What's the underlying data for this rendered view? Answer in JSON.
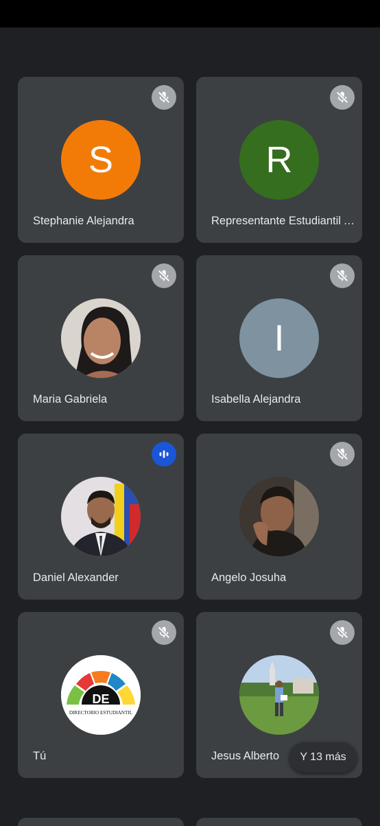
{
  "participants": [
    {
      "name": "Stephanie Alejandra",
      "initial": "S",
      "avatar_color": "#f27b08",
      "mic": "muted"
    },
    {
      "name": "Representante Estudiantil A...",
      "initial": "R",
      "avatar_color": "#356e1e",
      "mic": "muted"
    },
    {
      "name": "Maria Gabriela",
      "initial": "",
      "avatar_color": "#7a6a60",
      "mic": "muted"
    },
    {
      "name": "Isabella Alejandra",
      "initial": "I",
      "avatar_color": "#7e939f",
      "mic": "muted"
    },
    {
      "name": "Daniel Alexander",
      "initial": "",
      "avatar_color": "#5a4a50",
      "mic": "speaking"
    },
    {
      "name": "Angelo Josuha",
      "initial": "",
      "avatar_color": "#4a3e36",
      "mic": "muted"
    },
    {
      "name": "Tú",
      "initial": "",
      "avatar_color": "#ffffff",
      "mic": "muted",
      "logo_text": "DE",
      "logo_caption": "DIRECTORIO ESTUDIANTIL"
    },
    {
      "name": "Jesus Alberto",
      "initial": "",
      "avatar_color": "#6f8f50",
      "mic": "muted"
    }
  ],
  "more_button": {
    "label": "Y 13 más"
  }
}
